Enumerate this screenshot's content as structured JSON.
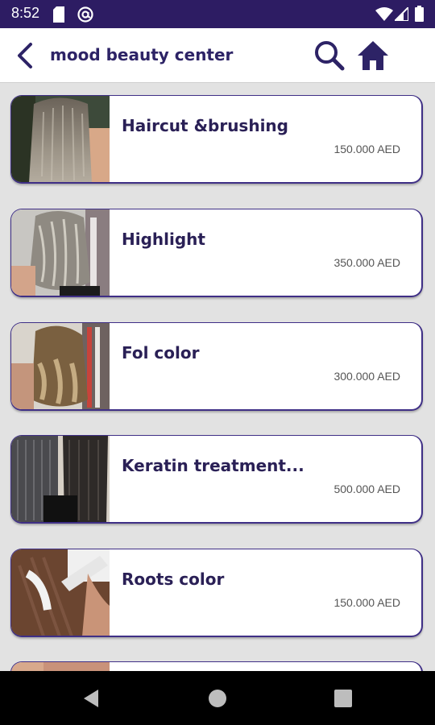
{
  "status_bar": {
    "time": "8:52",
    "icons": [
      "sd-card-icon",
      "at-sign-icon",
      "wifi-icon",
      "signal-icon",
      "battery-icon"
    ]
  },
  "app_bar": {
    "title": "mood beauty center",
    "back_icon": "chevron-left-icon",
    "search_icon": "search-icon",
    "home_icon": "home-icon"
  },
  "colors": {
    "brand": "#2d1c63",
    "title_text": "#2d2366",
    "card_border": "#3f2f86",
    "background": "#e2e2e2"
  },
  "services": [
    {
      "name": "Haircut &brushing",
      "price": "150.000 AED"
    },
    {
      "name": "Highlight",
      "price": "350.000 AED"
    },
    {
      "name": "Fol color",
      "price": "300.000 AED"
    },
    {
      "name": "Keratin treatment...",
      "price": "500.000 AED"
    },
    {
      "name": "Roots color",
      "price": "150.000 AED"
    }
  ],
  "nav_bar": {
    "back_icon": "nav-back-icon",
    "home_icon": "nav-home-icon",
    "recents_icon": "nav-recents-icon"
  }
}
